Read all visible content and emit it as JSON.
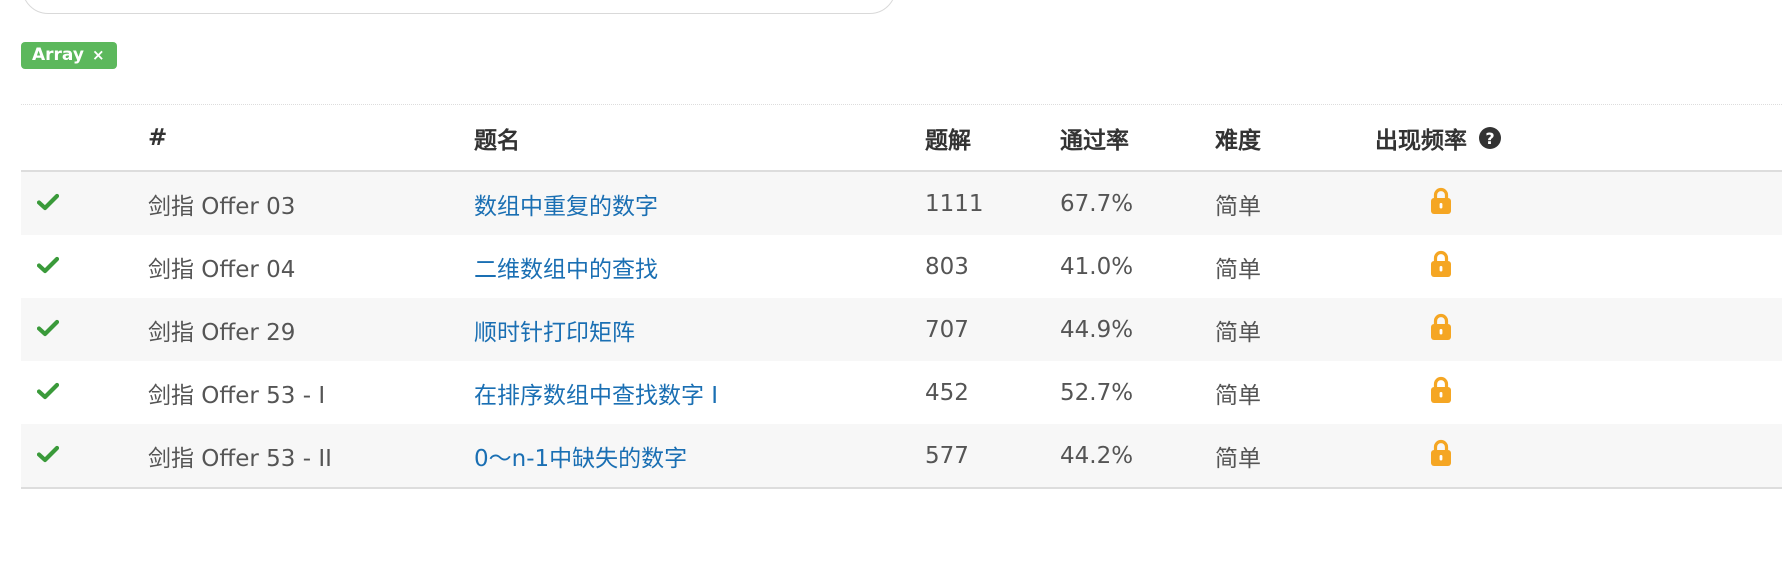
{
  "filter": {
    "tags": [
      {
        "label": "Array",
        "remove_icon": "×"
      }
    ]
  },
  "table": {
    "headers": {
      "id": "#",
      "title": "题名",
      "solutions": "题解",
      "acceptance": "通过率",
      "difficulty": "难度",
      "frequency": "出现频率",
      "frequency_help_icon": "?"
    },
    "rows": [
      {
        "status": "solved",
        "id": "剑指 Offer 03",
        "title": "数组中重复的数字",
        "solutions": "1111",
        "acceptance": "67.7%",
        "difficulty": "简单",
        "frequency": "locked"
      },
      {
        "status": "solved",
        "id": "剑指 Offer 04",
        "title": "二维数组中的查找",
        "solutions": "803",
        "acceptance": "41.0%",
        "difficulty": "简单",
        "frequency": "locked"
      },
      {
        "status": "solved",
        "id": "剑指 Offer 29",
        "title": "顺时针打印矩阵",
        "solutions": "707",
        "acceptance": "44.9%",
        "difficulty": "简单",
        "frequency": "locked"
      },
      {
        "status": "solved",
        "id": "剑指 Offer 53 - I",
        "title": "在排序数组中查找数字 I",
        "solutions": "452",
        "acceptance": "52.7%",
        "difficulty": "简单",
        "frequency": "locked"
      },
      {
        "status": "solved",
        "id": "剑指 Offer 53 - II",
        "title": "0～n-1中缺失的数字",
        "solutions": "577",
        "acceptance": "44.2%",
        "difficulty": "简单",
        "frequency": "locked"
      }
    ]
  },
  "colors": {
    "tag_bg": "#5cb85c",
    "link": "#1a6fb3",
    "easy": "#1e8a5c",
    "check": "#3a9a3a",
    "lock": "#f5a623"
  },
  "icons": {
    "status_solved": "check-icon",
    "frequency_locked": "lock-icon",
    "tag_remove": "close-icon",
    "frequency_help": "question-circle-icon"
  }
}
